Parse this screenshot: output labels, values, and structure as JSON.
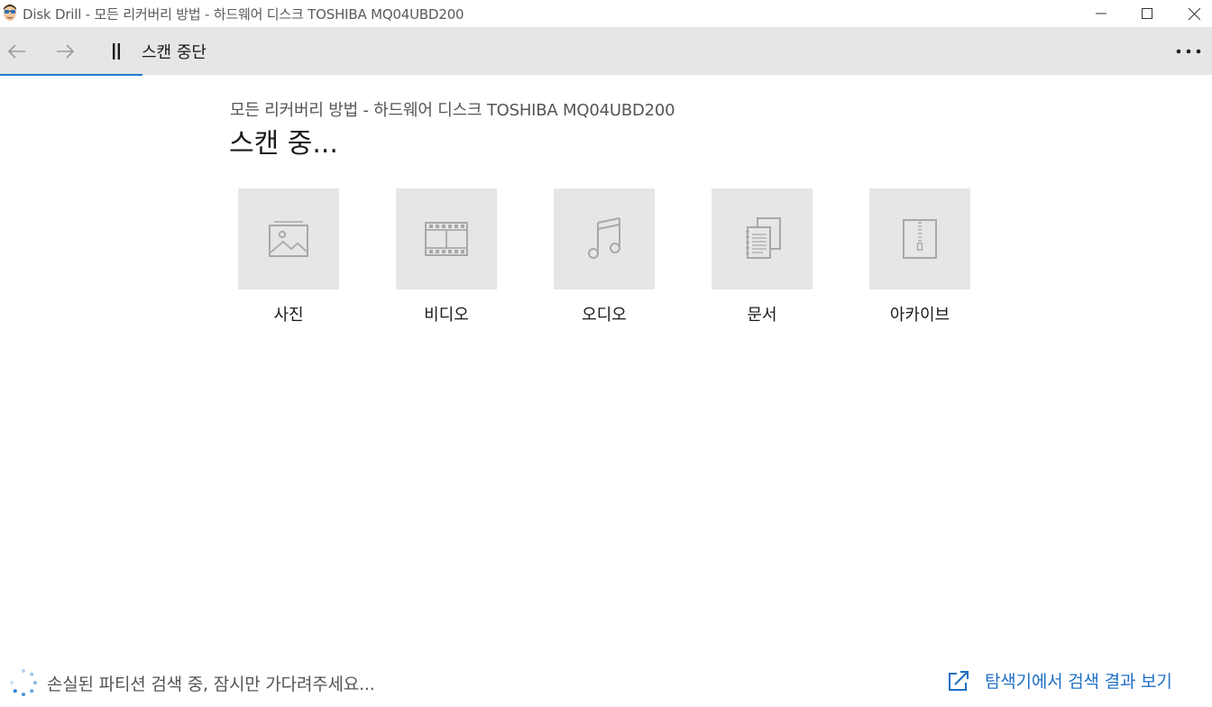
{
  "window": {
    "title": "Disk Drill - 모든 리커버리 방법 - 하드웨어 디스크 TOSHIBA MQ04UBD200",
    "app_icon": "disk-drill-logo",
    "controls": [
      "minimize-icon",
      "maximize-icon",
      "close-icon"
    ]
  },
  "toolbar": {
    "back_icon": "arrow-left-icon",
    "forward_icon": "arrow-right-icon",
    "pause_icon": "pause-icon",
    "pause_label": "스캔 중단",
    "more_icon": "more-horizontal-icon",
    "accent_color": "#1f7bd0"
  },
  "main": {
    "subtitle": "모든 리커버리 방법 - 하드웨어 디스크 TOSHIBA MQ04UBD200",
    "heading": "스캔 중...",
    "categories": [
      {
        "label": "사진",
        "icon": "photo-icon"
      },
      {
        "label": "비디오",
        "icon": "film-icon"
      },
      {
        "label": "오디오",
        "icon": "music-note-icon"
      },
      {
        "label": "문서",
        "icon": "documents-icon"
      },
      {
        "label": "아카이브",
        "icon": "zip-archive-icon"
      }
    ]
  },
  "status_bar": {
    "spinner_icon": "loading-spinner-icon",
    "status_text": "손실된 파티션 검색 중, 잠시만 가다려주세요...",
    "explorer_icon": "open-external-icon",
    "explorer_link": "탐색기에서 검색 결과 보기",
    "link_color": "#1f6fc5"
  }
}
